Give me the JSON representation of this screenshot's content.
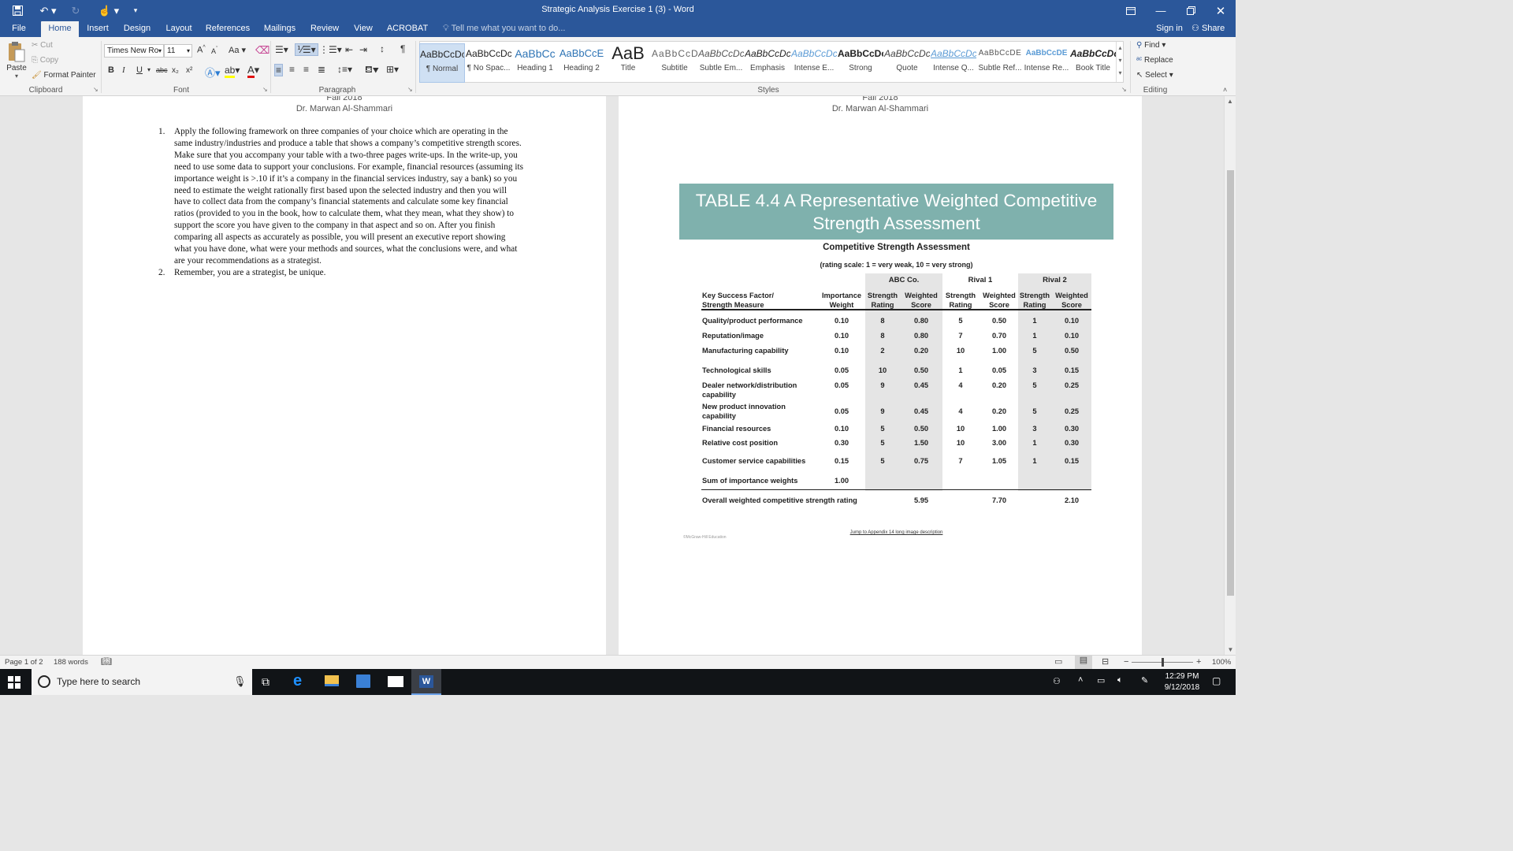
{
  "window": {
    "title": "Strategic Analysis Exercise 1 (3) - Word"
  },
  "tabs": [
    "File",
    "Home",
    "Insert",
    "Design",
    "Layout",
    "References",
    "Mailings",
    "Review",
    "View",
    "ACROBAT"
  ],
  "active_tab": "Home",
  "tell_me": "Tell me what you want to do...",
  "account": {
    "sign_in": "Sign in",
    "share": "Share"
  },
  "clipboard": {
    "paste": "Paste",
    "cut": "Cut",
    "copy": "Copy",
    "format_painter": "Format Painter",
    "group": "Clipboard"
  },
  "font": {
    "name": "Times New Ro",
    "size": "11",
    "group": "Font",
    "change_case": "Aa",
    "grow": "A",
    "shrink": "A",
    "bold": "B",
    "italic": "I",
    "underline": "U",
    "strike": "abc",
    "subscript": "x₂",
    "superscript": "x²"
  },
  "paragraph": {
    "group": "Paragraph"
  },
  "styles": {
    "group": "Styles",
    "items": [
      {
        "sample": "AaBbCcDc",
        "name": "¶ Normal"
      },
      {
        "sample": "AaBbCcDc",
        "name": "¶ No Spac..."
      },
      {
        "sample": "AaBbCc",
        "name": "Heading 1"
      },
      {
        "sample": "AaBbCcE",
        "name": "Heading 2"
      },
      {
        "sample": "AaB",
        "name": "Title"
      },
      {
        "sample": "AaBbCcD",
        "name": "Subtitle"
      },
      {
        "sample": "AaBbCcDc",
        "name": "Subtle Em..."
      },
      {
        "sample": "AaBbCcDc",
        "name": "Emphasis"
      },
      {
        "sample": "AaBbCcDc",
        "name": "Intense E..."
      },
      {
        "sample": "AaBbCcDc",
        "name": "Strong"
      },
      {
        "sample": "AaBbCcDc",
        "name": "Quote"
      },
      {
        "sample": "AaBbCcDc",
        "name": "Intense Q..."
      },
      {
        "sample": "AaBbCcDE",
        "name": "Subtle Ref..."
      },
      {
        "sample": "AaBbCcDE",
        "name": "Intense Re..."
      },
      {
        "sample": "AaBbCcDc",
        "name": "Book Title"
      }
    ]
  },
  "editing": {
    "group": "Editing",
    "find": "Find",
    "replace": "Replace",
    "select": "Select"
  },
  "page1": {
    "header_top": "Fall 2018",
    "header": "Dr. Marwan Al-Shammari",
    "list": [
      {
        "num": "1.",
        "lines": [
          "Apply the following framework on three companies of your choice which are operating in the",
          "same industry/industries and produce a table that shows a company’s competitive strength scores.",
          "Make sure that you accompany your table with a two-three pages write-ups. In the write-up, you",
          "need to use some data to support your conclusions. For example, financial resources (assuming its",
          "importance weight is >.10 if it’s a company in the financial services industry, say a bank) so you",
          "need to estimate the weight rationally first based upon the selected industry and then you will",
          "have to collect data from the company’s financial statements and calculate some key financial",
          "ratios (provided to you in the book, how to calculate them, what they mean, what they show) to",
          "support the score you have given to the company in that aspect and so on. After you finish",
          "comparing all aspects as accurately as possible, you will present an executive report showing",
          "what you have done, what were your methods and sources, what the conclusions were, and what",
          "are your recommendations as a strategist."
        ]
      },
      {
        "num": "2.",
        "lines": [
          "Remember, you are a strategist, be unique."
        ]
      }
    ]
  },
  "page2": {
    "header_top": "Fall 2018",
    "header": "Dr. Marwan Al-Shammari",
    "banner_line1": "TABLE 4.4 A Representative Weighted Competitive",
    "banner_line2": "Strength Assessment",
    "table_title": "Competitive Strength Assessment",
    "table_subtitle": "(rating scale: 1 = very weak, 10 = very strong)",
    "groups": [
      "ABC Co.",
      "Rival 1",
      "Rival 2"
    ],
    "col_headers": {
      "factor": [
        "Key Success Factor/",
        "Strength Measure"
      ],
      "importance": [
        "Importance",
        "Weight"
      ],
      "rating": [
        "Strength",
        "Rating"
      ],
      "score": [
        "Weighted",
        "Score"
      ]
    },
    "rows": [
      {
        "factor": [
          "Quality/product performance"
        ],
        "w": "0.10",
        "v": [
          "8",
          "0.80",
          "5",
          "0.50",
          "1",
          "0.10"
        ]
      },
      {
        "factor": [
          "Reputation/image"
        ],
        "w": "0.10",
        "v": [
          "8",
          "0.80",
          "7",
          "0.70",
          "1",
          "0.10"
        ]
      },
      {
        "factor": [
          "Manufacturing capability"
        ],
        "w": "0.10",
        "v": [
          "2",
          "0.20",
          "10",
          "1.00",
          "5",
          "0.50"
        ]
      },
      {
        "factor": [
          "Technological skills"
        ],
        "w": "0.05",
        "v": [
          "10",
          "0.50",
          "1",
          "0.05",
          "3",
          "0.15"
        ]
      },
      {
        "factor": [
          "Dealer network/distribution",
          "capability"
        ],
        "w": "0.05",
        "v": [
          "9",
          "0.45",
          "4",
          "0.20",
          "5",
          "0.25"
        ]
      },
      {
        "factor": [
          "New product innovation",
          "capability"
        ],
        "w": "0.05",
        "v": [
          "9",
          "0.45",
          "4",
          "0.20",
          "5",
          "0.25"
        ]
      },
      {
        "factor": [
          "Financial resources"
        ],
        "w": "0.10",
        "v": [
          "5",
          "0.50",
          "10",
          "1.00",
          "3",
          "0.30"
        ]
      },
      {
        "factor": [
          "Relative cost position"
        ],
        "w": "0.30",
        "v": [
          "5",
          "1.50",
          "10",
          "3.00",
          "1",
          "0.30"
        ]
      },
      {
        "factor": [
          "Customer service capabilities"
        ],
        "w": "0.15",
        "v": [
          "5",
          "0.75",
          "7",
          "1.05",
          "1",
          "0.15"
        ]
      }
    ],
    "sum_label": "Sum of importance weights",
    "sum_value": "1.00",
    "overall_label": "Overall weighted competitive strength rating",
    "overall": [
      "5.95",
      "7.70",
      "2.10"
    ],
    "footnote": "©McGraw-Hill Education",
    "link": "Jump to Appendix 14 long image description"
  },
  "status": {
    "page": "Page 1 of 2",
    "words": "188 words",
    "zoom": "100%"
  },
  "taskbar": {
    "search": "Type here to search",
    "time": "12:29 PM",
    "date": "9/12/2018"
  }
}
